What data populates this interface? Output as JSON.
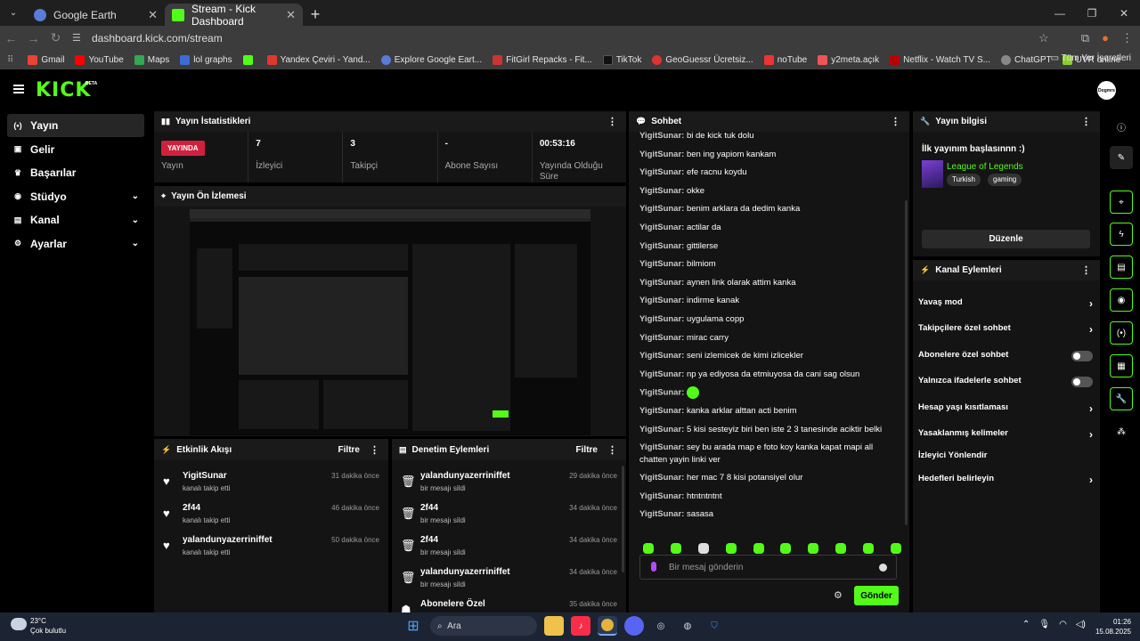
{
  "browser": {
    "tabs": [
      {
        "label": "Google Earth",
        "active": false
      },
      {
        "label": "Stream - Kick Dashboard",
        "active": true
      }
    ],
    "url": "dashboard.kick.com/stream",
    "bookmarks": [
      "Gmail",
      "YouTube",
      "Maps",
      "lol graphs",
      "",
      "Yandex Çeviri - Yand...",
      "Explore Google Eart...",
      "FitGirl Repacks - Fit...",
      "TikTok",
      "GeoGuessr Ücretsiz...",
      "noTube",
      "y2meta.açık",
      "Netflix - Watch TV S...",
      "ChatGPT",
      "UVR online"
    ],
    "all_bookmarks": "Tüm Yer İşaretleri"
  },
  "brand": {
    "logo": "KICK",
    "beta": "BETA",
    "avatar": "Dogmrs",
    "accent": "#53fc18"
  },
  "sidebar": {
    "items": [
      {
        "label": "Yayın",
        "icon": "broadcast-icon",
        "active": true,
        "expandable": false
      },
      {
        "label": "Gelir",
        "icon": "revenue-icon",
        "active": false,
        "expandable": false
      },
      {
        "label": "Başarılar",
        "icon": "trophy-icon",
        "active": false,
        "expandable": false
      },
      {
        "label": "Stüdyo",
        "icon": "studio-icon",
        "active": false,
        "expandable": true
      },
      {
        "label": "Kanal",
        "icon": "channel-icon",
        "active": false,
        "expandable": true
      },
      {
        "label": "Ayarlar",
        "icon": "gear-icon",
        "active": false,
        "expandable": true
      }
    ]
  },
  "stats": {
    "title": "Yayın İstatistikleri",
    "items": [
      {
        "value": "YAYINDA",
        "label": "Yayın"
      },
      {
        "value": "7",
        "label": "İzleyici"
      },
      {
        "value": "3",
        "label": "Takipçi"
      },
      {
        "value": "-",
        "label": "Abone Sayısı"
      },
      {
        "value": "00:53:16",
        "label": "Yayında Olduğu Süre"
      }
    ]
  },
  "preview": {
    "title": "Yayın Ön İzlemesi"
  },
  "activity": {
    "title": "Etkinlik Akışı",
    "filter": "Filtre",
    "items": [
      {
        "user": "YigitSunar",
        "action": "kanalı takip etti",
        "time": "31 dakika önce"
      },
      {
        "user": "2f44",
        "action": "kanalı takip etti",
        "time": "46 dakika önce"
      },
      {
        "user": "yalandunyazerriniffet",
        "action": "kanalı takip etti",
        "time": "50 dakika önce"
      }
    ]
  },
  "moderation": {
    "title": "Denetim Eylemleri",
    "filter": "Filtre",
    "items": [
      {
        "user": "yalandunyazerriniffet",
        "action": "bir mesajı sildi",
        "time": "29 dakika önce"
      },
      {
        "user": "2f44",
        "action": "bir mesajı sildi",
        "time": "34 dakika önce"
      },
      {
        "user": "2f44",
        "action": "bir mesajı sildi",
        "time": "34 dakika önce"
      },
      {
        "user": "yalandunyazerriniffet",
        "action": "bir mesajı sildi",
        "time": "34 dakika önce"
      },
      {
        "user": "Abonelere Özel",
        "action": "",
        "time": "35 dakika önce"
      }
    ]
  },
  "chat": {
    "title": "Sohbet",
    "messages": [
      {
        "user": "YigitSunar:",
        "text": "bi de kick tuk dolu"
      },
      {
        "user": "YigitSunar:",
        "text": "ben ing yapiom kankam"
      },
      {
        "user": "YigitSunar:",
        "text": "efe racnu koydu"
      },
      {
        "user": "YigitSunar:",
        "text": "okke"
      },
      {
        "user": "YigitSunar:",
        "text": "benim arklara da dedim kanka"
      },
      {
        "user": "YigitSunar:",
        "text": "actilar da"
      },
      {
        "user": "YigitSunar:",
        "text": "gittilerse"
      },
      {
        "user": "YigitSunar:",
        "text": "bilmiom"
      },
      {
        "user": "YigitSunar:",
        "text": "aynen link olarak attim kanka"
      },
      {
        "user": "YigitSunar:",
        "text": "indirme kanak"
      },
      {
        "user": "YigitSunar:",
        "text": "uygulama copp"
      },
      {
        "user": "YigitSunar:",
        "text": "mirac carry"
      },
      {
        "user": "YigitSunar:",
        "text": "seni izlemicek de kimi izlicekler"
      },
      {
        "user": "YigitSunar:",
        "text": "np ya ediyosa da etmiuyosa da cani sag olsun"
      },
      {
        "user": "YigitSunar:",
        "text": ""
      },
      {
        "user": "YigitSunar:",
        "text": "kanka arklar alttan acti benim"
      },
      {
        "user": "YigitSunar:",
        "text": "5 kisi sesteyiz biri ben iste 2 3 tanesinde aciktir belki"
      },
      {
        "user": "YigitSunar:",
        "text": "sey bu arada map e foto koy kanka kapat mapi all chatten yayin linki ver"
      },
      {
        "user": "YigitSunar:",
        "text": "her mac 7 8 kisi potansiyel olur"
      },
      {
        "user": "YigitSunar:",
        "text": "htntntntnt"
      },
      {
        "user": "YigitSunar:",
        "text": "sasasa"
      }
    ],
    "placeholder": "Bir mesaj gönderin",
    "send": "Gönder"
  },
  "stream_info": {
    "title": "Yayın bilgisi",
    "stream_title": "İlk yayınım başlasınnn :)",
    "category": "League of Legends",
    "tags": [
      "Turkish",
      "gaming"
    ],
    "edit": "Düzenle"
  },
  "channel_actions": {
    "title": "Kanal Eylemleri",
    "items": [
      {
        "label": "Yavaş mod",
        "control": "chevron"
      },
      {
        "label": "Takipçilere özel sohbet",
        "control": "chevron"
      },
      {
        "label": "Abonelere özel sohbet",
        "control": "toggle",
        "on": false
      },
      {
        "label": "Yalnızca ifadelerle sohbet",
        "control": "toggle",
        "on": false
      },
      {
        "label": "Hesap yaşı kısıtlaması",
        "control": "chevron"
      },
      {
        "label": "Yasaklanmış kelimeler",
        "control": "chevron"
      },
      {
        "label": "İzleyici Yönlendir",
        "control": "none"
      },
      {
        "label": "Hedefleri belirleyin",
        "control": "chevron"
      }
    ]
  },
  "taskbar": {
    "weather_temp": "23°C",
    "weather_desc": "Çok bulutlu",
    "search": "Ara",
    "time": "01:26",
    "date": "15.08.2025"
  }
}
